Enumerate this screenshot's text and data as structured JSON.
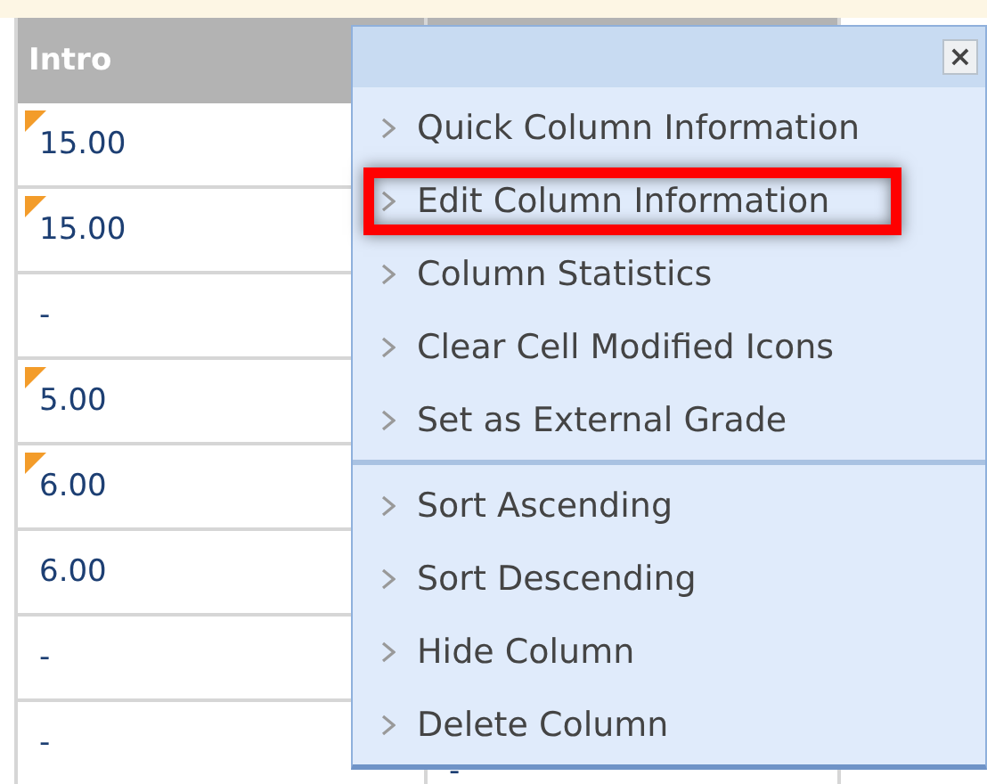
{
  "table": {
    "columns": [
      {
        "label": "Intro"
      }
    ],
    "rows": [
      {
        "value": "15.00",
        "modified": true
      },
      {
        "value": "15.00",
        "modified": true
      },
      {
        "value": "-",
        "modified": false
      },
      {
        "value": "5.00",
        "modified": true
      },
      {
        "value": "6.00",
        "modified": true
      },
      {
        "value": "6.00",
        "modified": false
      },
      {
        "value": "-",
        "modified": false
      },
      {
        "value": "-",
        "modified": false
      }
    ],
    "column_2_last_cell": "-"
  },
  "menu": {
    "close": "×",
    "groups": [
      {
        "items": [
          {
            "label": "Quick Column Information",
            "highlighted": false
          },
          {
            "label": "Edit Column Information",
            "highlighted": true
          },
          {
            "label": "Column Statistics",
            "highlighted": false
          },
          {
            "label": "Clear Cell Modified Icons",
            "highlighted": false
          },
          {
            "label": "Set as External Grade",
            "highlighted": false
          }
        ]
      },
      {
        "items": [
          {
            "label": "Sort Ascending",
            "highlighted": false
          },
          {
            "label": "Sort Descending",
            "highlighted": false
          },
          {
            "label": "Hide Column",
            "highlighted": false
          },
          {
            "label": "Delete Column",
            "highlighted": false
          }
        ]
      }
    ]
  }
}
